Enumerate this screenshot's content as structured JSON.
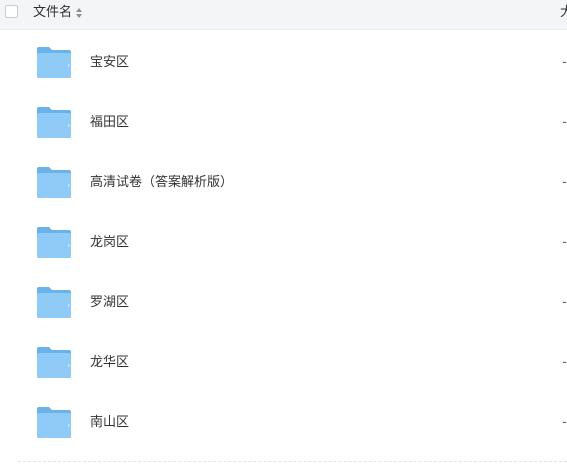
{
  "header": {
    "column_name_label": "文件名",
    "column_next_label": "大"
  },
  "files": [
    {
      "name": "宝安区",
      "value": "-",
      "icon": "folder-icon"
    },
    {
      "name": "福田区",
      "value": "-",
      "icon": "folder-icon"
    },
    {
      "name": "高清试卷（答案解析版）",
      "value": "-",
      "icon": "folder-icon"
    },
    {
      "name": "龙岗区",
      "value": "-",
      "icon": "folder-icon"
    },
    {
      "name": "罗湖区",
      "value": "-",
      "icon": "folder-icon"
    },
    {
      "name": "龙华区",
      "value": "-",
      "icon": "folder-icon"
    },
    {
      "name": "南山区",
      "value": "-",
      "icon": "folder-icon"
    }
  ],
  "colors": {
    "folder_back": "#6ab2ec",
    "folder_front": "#8fcbf6",
    "header_bg": "#f4f5f7"
  }
}
